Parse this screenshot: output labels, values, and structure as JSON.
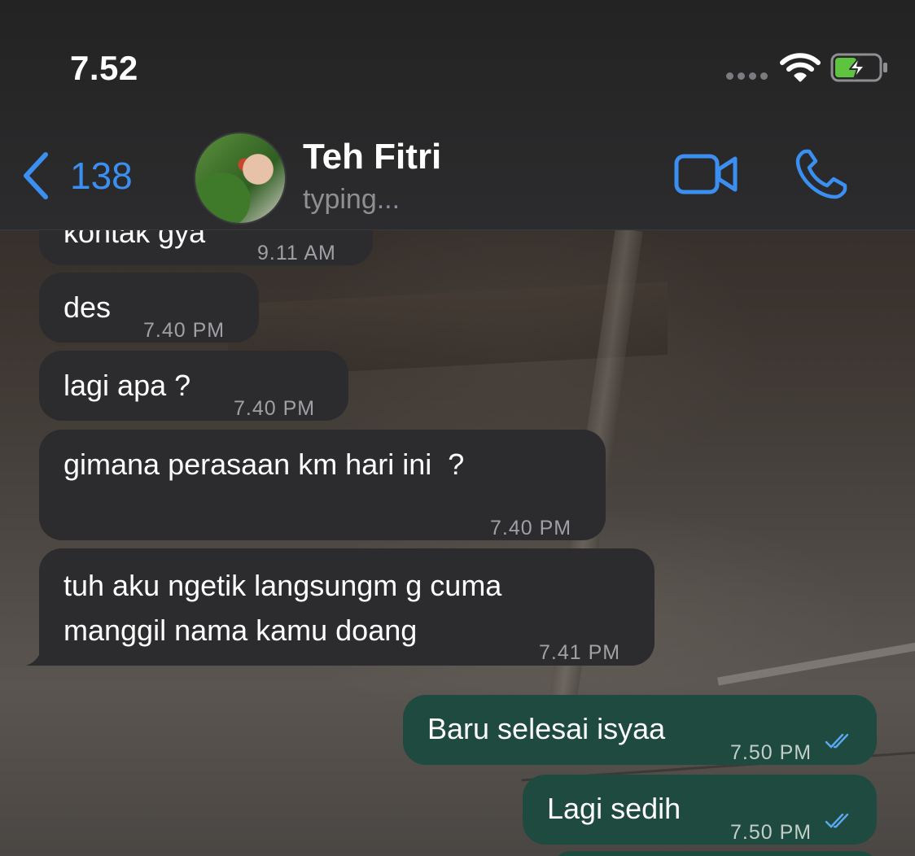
{
  "status_bar": {
    "time": "7.52"
  },
  "header": {
    "back_count": "138",
    "contact_name": "Teh Fitri",
    "contact_status": "typing...",
    "icons": [
      "chevron-left-icon",
      "video-call-icon",
      "phone-icon",
      "wifi-icon",
      "battery-charging-icon"
    ]
  },
  "messages": [
    {
      "direction": "in",
      "text": "kontak gya",
      "time": "9.11 AM"
    },
    {
      "direction": "in",
      "text": "des",
      "time": "7.40 PM"
    },
    {
      "direction": "in",
      "text": "lagi apa ?",
      "time": "7.40 PM"
    },
    {
      "direction": "in",
      "text": "gimana perasaan km hari ini  ?",
      "time": "7.40 PM"
    },
    {
      "direction": "in",
      "text_line1": "tuh aku ngetik langsungm g cuma",
      "text_line2": "manggil nama kamu doang",
      "time": "7.41 PM"
    },
    {
      "direction": "out",
      "text": "Baru selesai isyaa",
      "time": "7.50 PM",
      "status": "read"
    },
    {
      "direction": "out",
      "text": "Lagi sedih",
      "time": "7.50 PM",
      "status": "read"
    }
  ],
  "colors": {
    "accent": "#3b8ff0",
    "incoming_bubble": "#2c2c2e",
    "outgoing_bubble": "#1e4a3f",
    "battery_green": "#5ec33f"
  }
}
